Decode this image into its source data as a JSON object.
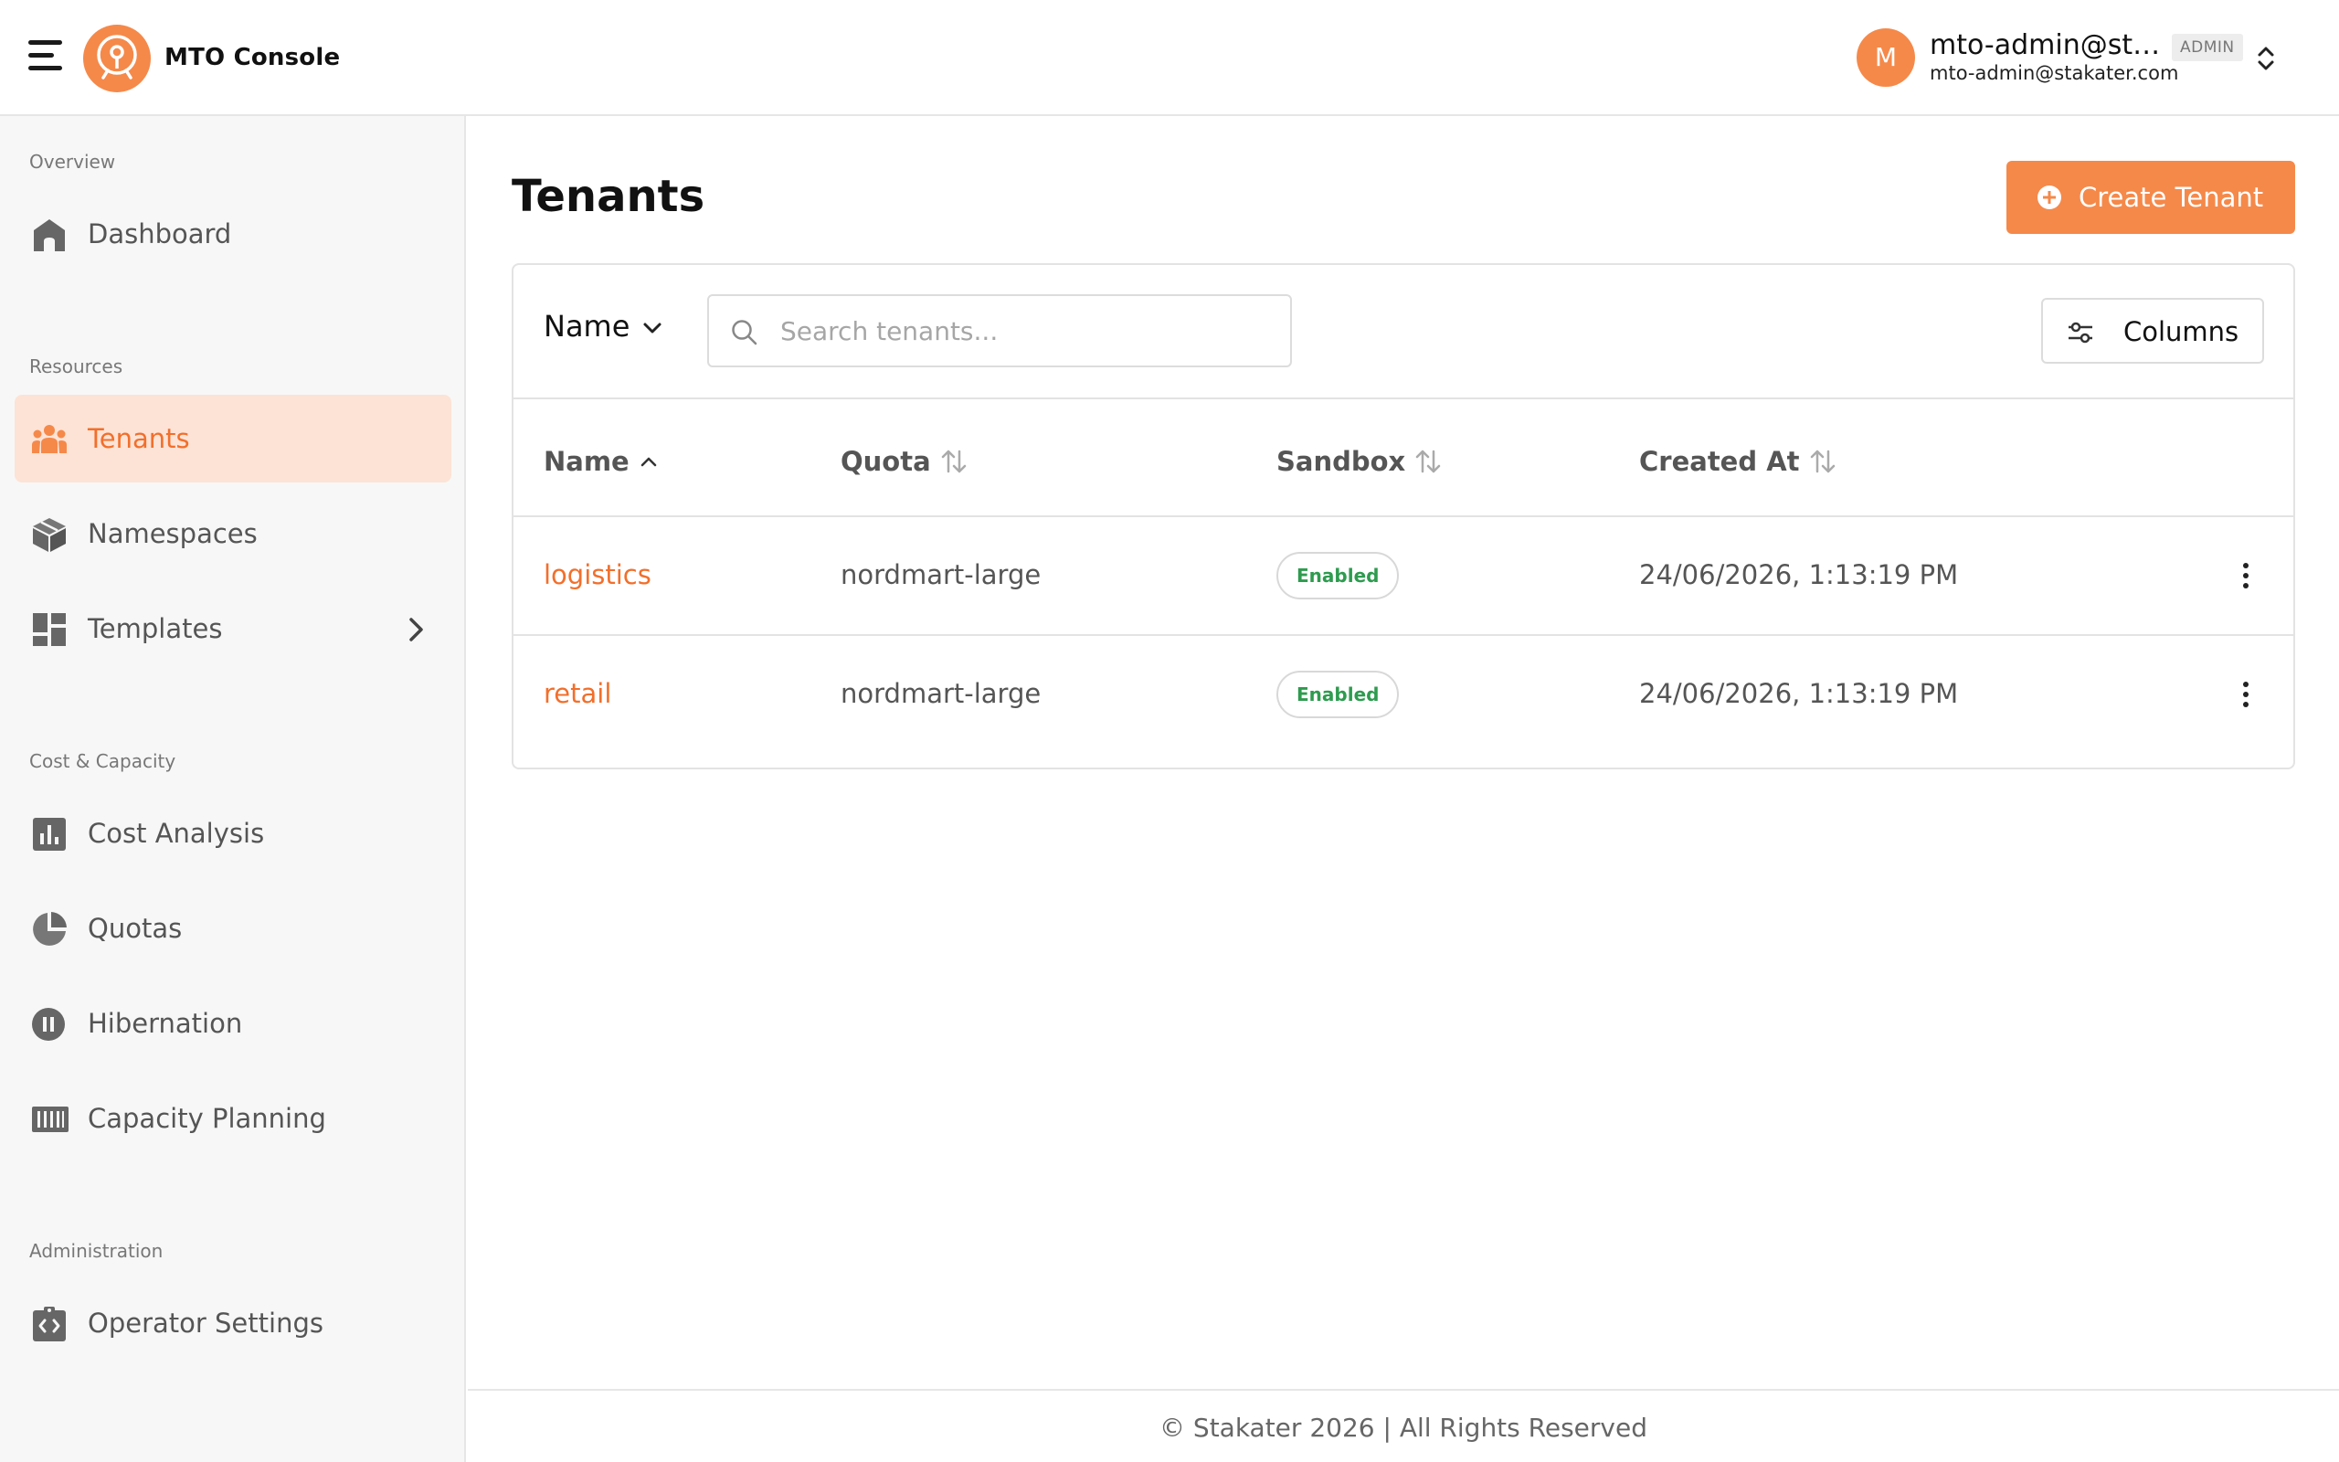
{
  "header": {
    "app_title": "MTO Console",
    "user": {
      "avatar_initial": "M",
      "name": "mto-admin@sta...",
      "role_badge": "ADMIN",
      "email": "mto-admin@stakater.com"
    }
  },
  "sidebar": {
    "sections": {
      "overview": "Overview",
      "resources": "Resources",
      "cost_capacity": "Cost & Capacity",
      "administration": "Administration"
    },
    "items": {
      "dashboard": "Dashboard",
      "tenants": "Tenants",
      "namespaces": "Namespaces",
      "templates": "Templates",
      "cost_analysis": "Cost Analysis",
      "quotas": "Quotas",
      "hibernation": "Hibernation",
      "capacity_planning": "Capacity Planning",
      "operator_settings": "Operator Settings"
    },
    "active_item": "tenants"
  },
  "main": {
    "title": "Tenants",
    "create_button": "Create Tenant",
    "filter_field": "Name",
    "search_placeholder": "Search tenants...",
    "columns_button": "Columns",
    "table": {
      "headers": {
        "name": "Name",
        "quota": "Quota",
        "sandbox": "Sandbox",
        "created_at": "Created At"
      },
      "rows": [
        {
          "name": "logistics",
          "quota": "nordmart-large",
          "sandbox": "Enabled",
          "created_at": "24/06/2026, 1:13:19 PM"
        },
        {
          "name": "retail",
          "quota": "nordmart-large",
          "sandbox": "Enabled",
          "created_at": "24/06/2026, 1:13:19 PM"
        }
      ]
    }
  },
  "footer": {
    "text": "© Stakater 2026 | All Rights Reserved"
  },
  "colors": {
    "accent": "#f5894a",
    "accent_text": "#f26f2b",
    "active_bg": "#fde3d6",
    "enabled_green": "#2e9b4f"
  },
  "icons": {
    "menu": "hamburger-icon",
    "logo": "stakater-logo",
    "dashboard": "home-icon",
    "tenants": "groups-icon",
    "namespaces": "cube-icon",
    "templates": "dashboard-grid-icon",
    "cost_analysis": "bar-chart-icon",
    "quotas": "pie-chart-icon",
    "hibernation": "pause-circle-icon",
    "capacity_planning": "barcode-icon",
    "operator_settings": "code-clipboard-icon"
  }
}
